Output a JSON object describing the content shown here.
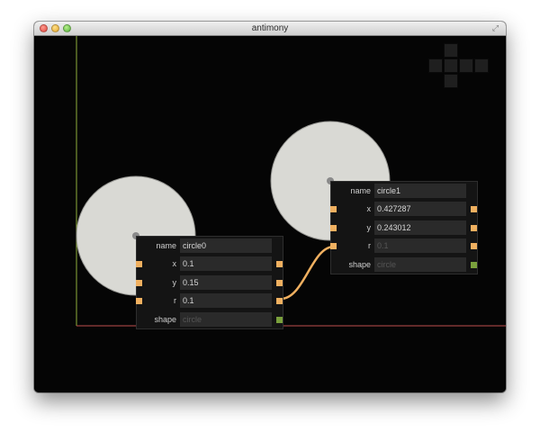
{
  "window": {
    "title": "antimony"
  },
  "colors": {
    "canvas_bg": "#050505",
    "node_bg": "#141414",
    "field_bg": "#2a2a2a",
    "port_float": "#f0b060",
    "port_shape": "#7aa03c",
    "connection": "#f0b060",
    "axis_y": "#8fae3a",
    "axis_x": "#c0504d",
    "circle_fill": "#d9d9d4"
  },
  "nodes": [
    {
      "id": "circle0",
      "rows": [
        {
          "label": "name",
          "value": "circle0",
          "input": false,
          "output": false
        },
        {
          "label": "x",
          "value": "0.1",
          "input": true,
          "output": true
        },
        {
          "label": "y",
          "value": "0.15",
          "input": true,
          "output": true
        },
        {
          "label": "r",
          "value": "0.1",
          "input": true,
          "output": true
        },
        {
          "label": "shape",
          "value": "circle",
          "input": false,
          "output": true,
          "dim": true
        }
      ]
    },
    {
      "id": "circle1",
      "rows": [
        {
          "label": "name",
          "value": "circle1",
          "input": false,
          "output": false
        },
        {
          "label": "x",
          "value": "0.427287",
          "input": true,
          "output": true
        },
        {
          "label": "y",
          "value": "0.243012",
          "input": true,
          "output": true
        },
        {
          "label": "r",
          "value": "0.1",
          "input": true,
          "output": true,
          "dim": true
        },
        {
          "label": "shape",
          "value": "circle",
          "input": false,
          "output": true,
          "dim": true
        }
      ]
    }
  ]
}
